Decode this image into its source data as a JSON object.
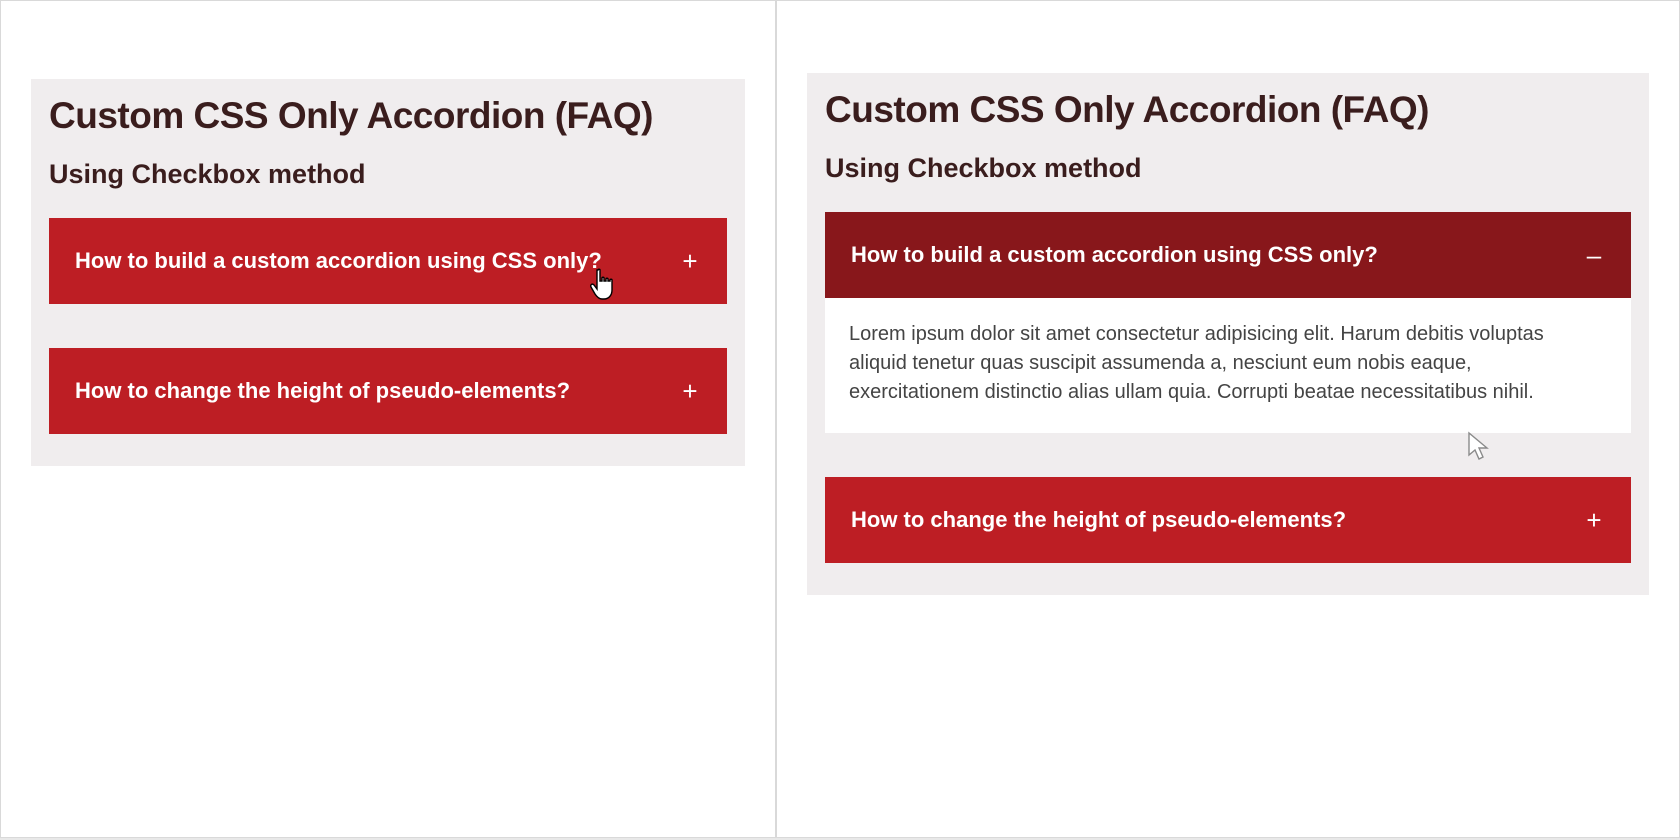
{
  "title": "Custom CSS Only Accordion (FAQ)",
  "subtitle": "Using Checkbox method",
  "accordion": {
    "items": [
      {
        "question": "How to build a custom accordion using CSS only?",
        "answer": "Lorem ipsum dolor sit amet consectetur adipisicing elit. Harum debitis voluptas aliquid tenetur quas suscipit assumenda a, nesciunt eum nobis eaque, exercitationem distinctio alias ullam quia. Corrupti beatae necessitatibus nihil."
      },
      {
        "question": "How to change the height of pseudo-elements?",
        "answer": ""
      }
    ]
  },
  "glyphs": {
    "plus": "+",
    "minus": "–"
  },
  "left_pane": {
    "item0_expanded": false,
    "item1_expanded": false
  },
  "right_pane": {
    "item0_expanded": true,
    "item1_expanded": false
  }
}
